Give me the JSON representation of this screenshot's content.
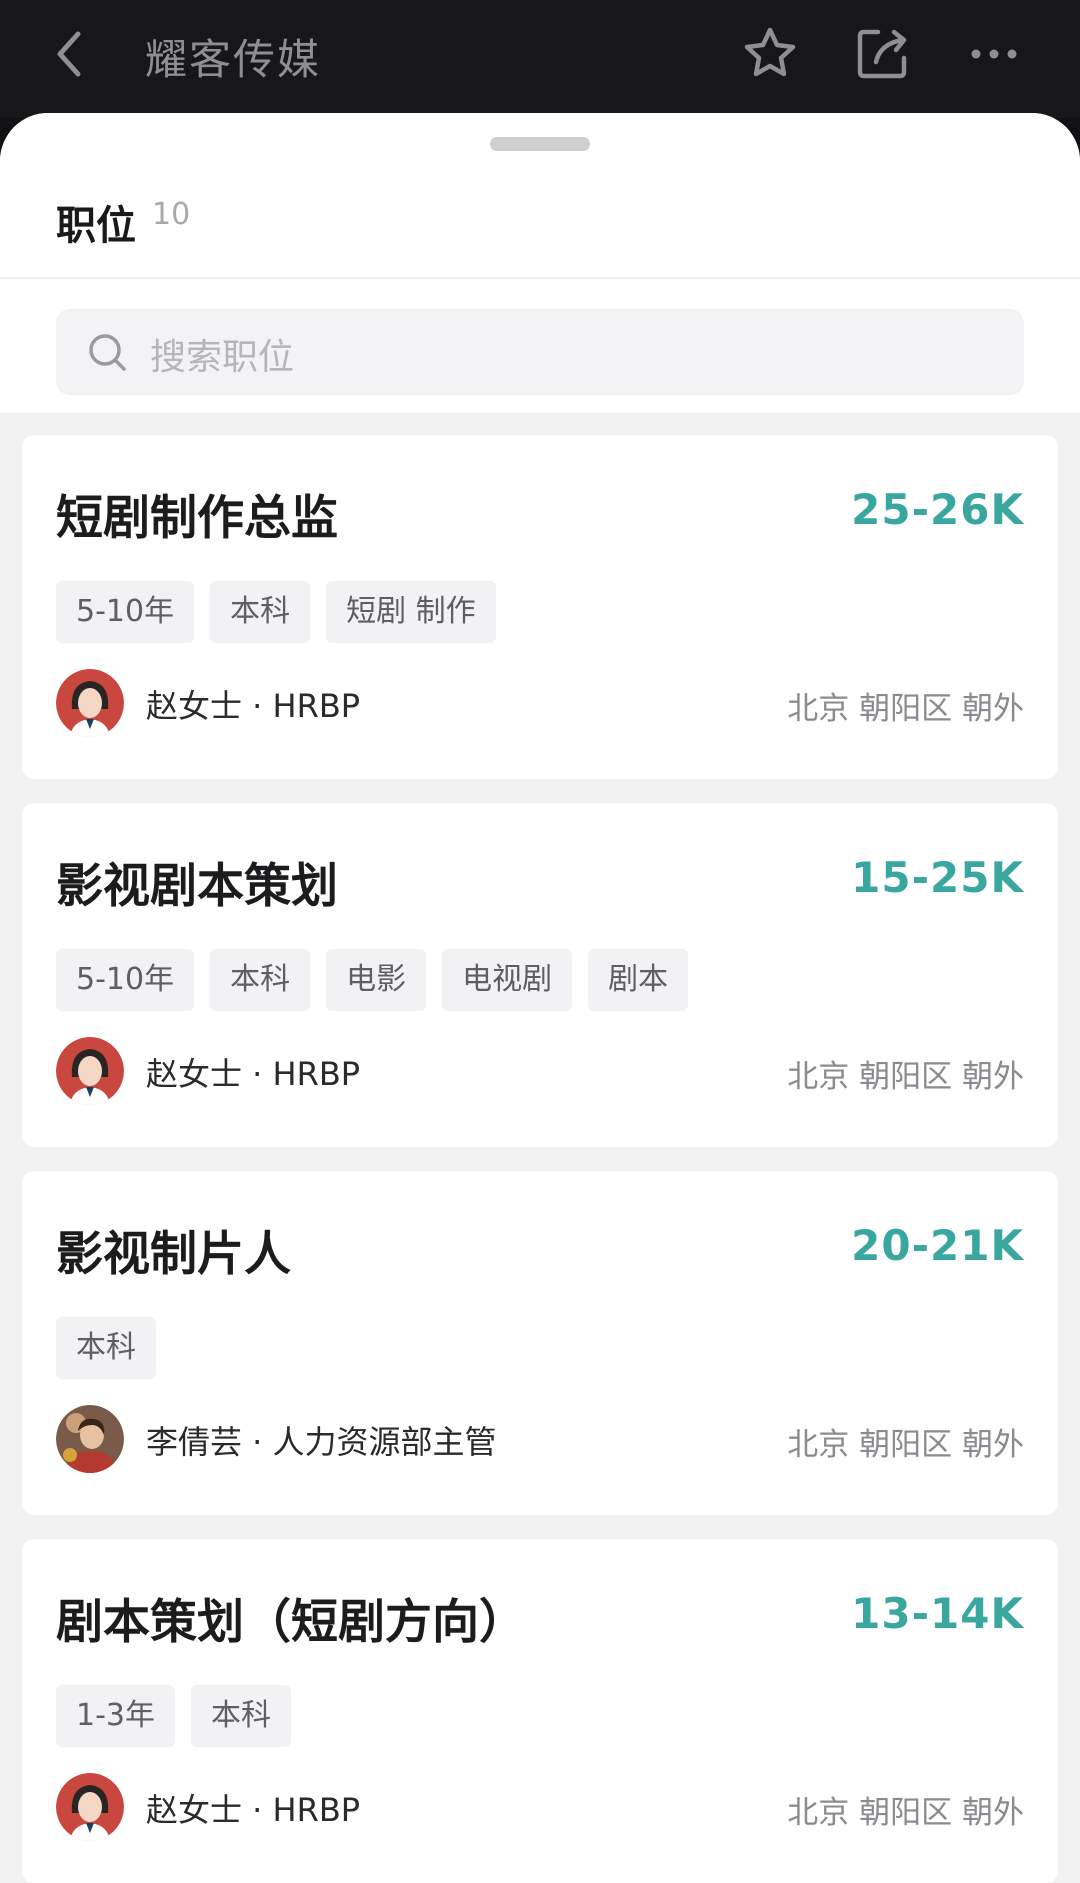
{
  "header": {
    "title": "耀客传媒",
    "back_icon": "chevron-left-icon",
    "favorite_icon": "star-icon",
    "share_icon": "share-icon",
    "more_icon": "more-horizontal-icon"
  },
  "section": {
    "title": "职位",
    "count": "10"
  },
  "search": {
    "placeholder": "搜索职位",
    "icon": "search-icon"
  },
  "colors": {
    "salary": "#3aa6a0",
    "page_bg": "#f2f2f3",
    "topbar_bg": "#17171a"
  },
  "jobs": [
    {
      "title": "短剧制作总监",
      "salary": "25-26K",
      "tags": [
        "5-10年",
        "本科",
        "短剧 制作"
      ],
      "recruiter": "赵女士 · HRBP",
      "location": "北京 朝阳区 朝外",
      "avatar": "illustrated-woman-avatar"
    },
    {
      "title": "影视剧本策划",
      "salary": "15-25K",
      "tags": [
        "5-10年",
        "本科",
        "电影",
        "电视剧",
        "剧本"
      ],
      "recruiter": "赵女士 · HRBP",
      "location": "北京 朝阳区 朝外",
      "avatar": "illustrated-woman-avatar"
    },
    {
      "title": "影视制片人",
      "salary": "20-21K",
      "tags": [
        "本科"
      ],
      "recruiter": "李倩芸 · 人力资源部主管",
      "location": "北京 朝阳区 朝外",
      "avatar": "photo-avatar"
    },
    {
      "title": "剧本策划（短剧方向）",
      "salary": "13-14K",
      "tags": [
        "1-3年",
        "本科"
      ],
      "recruiter": "赵女士 · HRBP",
      "location": "北京 朝阳区 朝外",
      "avatar": "illustrated-woman-avatar"
    }
  ]
}
